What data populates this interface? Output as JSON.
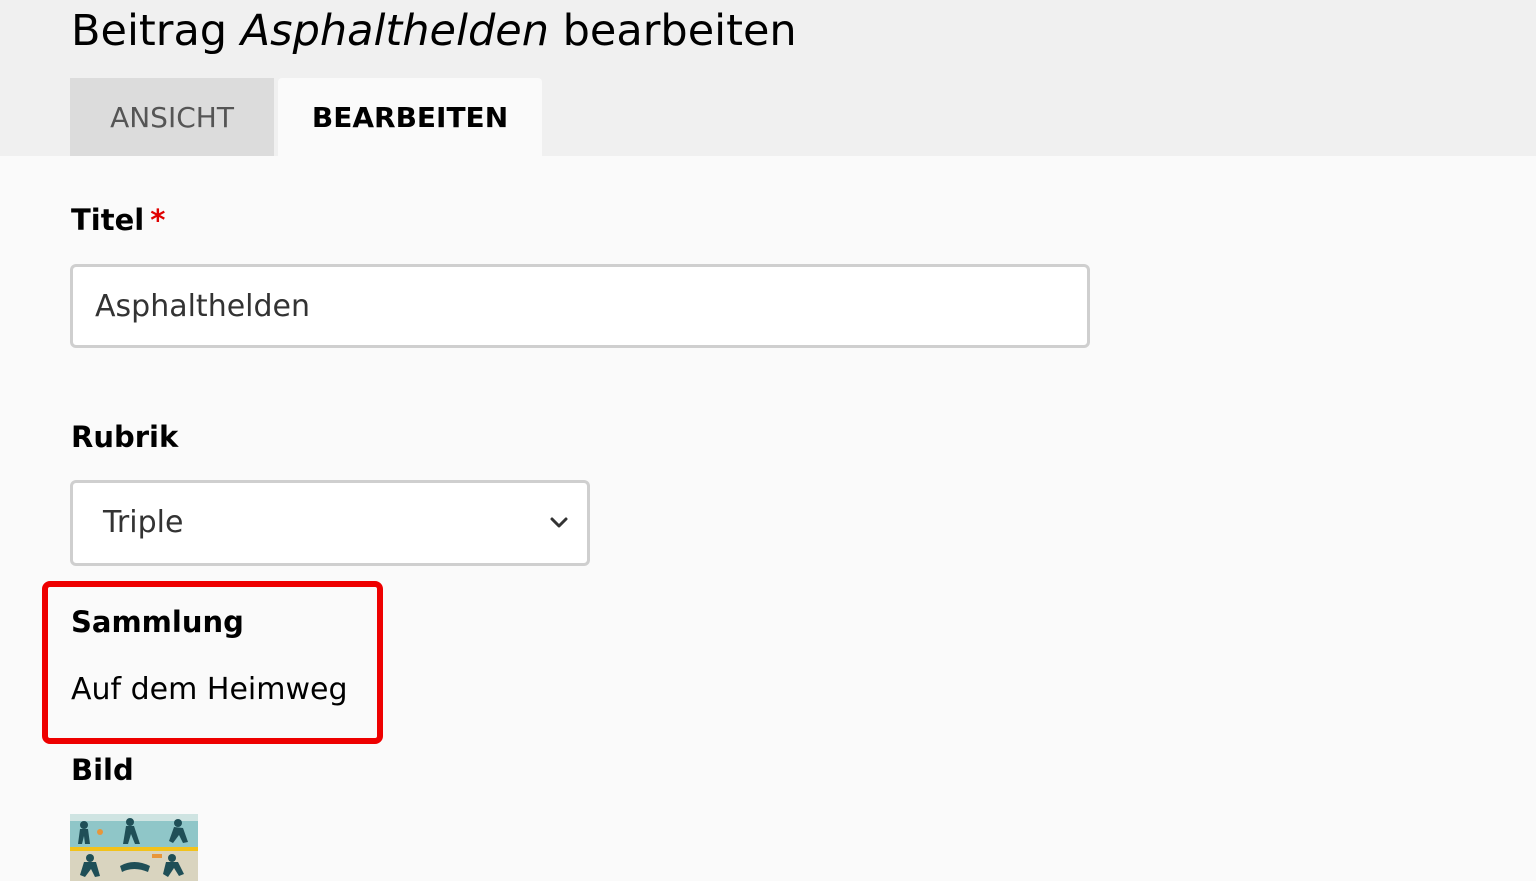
{
  "header": {
    "title_prefix": "Beitrag ",
    "title_item": "Asphalthelden",
    "title_suffix": " bearbeiten",
    "tabs": [
      {
        "label": "ANSICHT",
        "active": false
      },
      {
        "label": "BEARBEITEN",
        "active": true
      }
    ]
  },
  "form": {
    "title_field": {
      "label": "Titel",
      "required_mark": "*",
      "value": "Asphalthelden"
    },
    "category_field": {
      "label": "Rubrik",
      "selected": "Triple"
    },
    "collection_field": {
      "label": "Sammlung",
      "value": "Auf dem Heimweg"
    },
    "image_field": {
      "label": "Bild"
    }
  },
  "colors": {
    "highlight": "#ee0000",
    "required": "#e00000"
  }
}
